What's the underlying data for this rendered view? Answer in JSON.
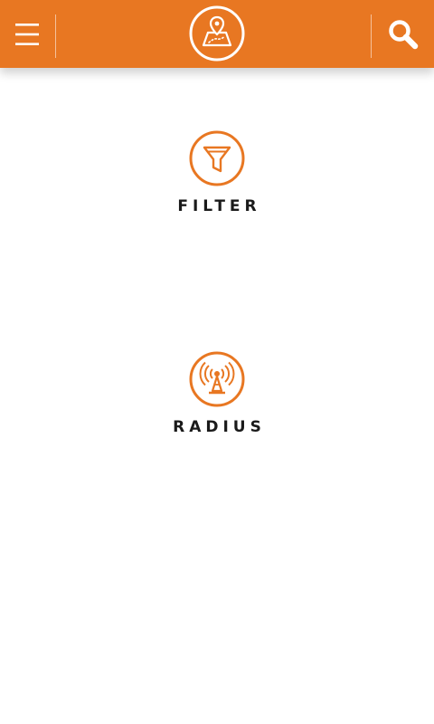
{
  "header": {
    "background_color": "#e87722",
    "menu_icon": "hamburger-menu-icon",
    "logo_icon": "map-pin-logo-icon",
    "search_icon": "search-icon"
  },
  "options": [
    {
      "label": "FILTER",
      "icon": "filter-funnel-icon"
    },
    {
      "label": "RADIUS",
      "icon": "radio-tower-icon"
    }
  ],
  "accent_color": "#e87722"
}
